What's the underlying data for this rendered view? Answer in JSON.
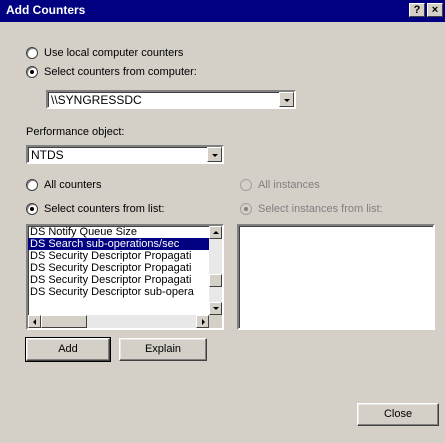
{
  "window": {
    "title": "Add Counters",
    "help_button": "?",
    "close_button": "×"
  },
  "source": {
    "local_label": "Use local computer counters",
    "remote_label": "Select counters from computer:",
    "selected": "remote",
    "computer_value": "\\\\SYNGRESSDC"
  },
  "performance_object": {
    "label": "Performance object:",
    "value": "NTDS"
  },
  "counters": {
    "all_label": "All counters",
    "select_label": "Select counters from list:",
    "selected": "list",
    "items": [
      "DS Notify Queue Size",
      "DS Search sub-operations/sec",
      "DS Security Descriptor Propagati",
      "DS Security Descriptor Propagati",
      "DS Security Descriptor Propagati",
      "DS Security Descriptor sub-opera"
    ],
    "selected_index": 1
  },
  "instances": {
    "all_label": "All instances",
    "select_label": "Select instances from list:",
    "enabled": false
  },
  "buttons": {
    "add": "Add",
    "explain": "Explain",
    "close": "Close"
  },
  "colors": {
    "dialog_bg": "#d4d0c8",
    "titlebar": "#000080",
    "selection": "#000080"
  }
}
